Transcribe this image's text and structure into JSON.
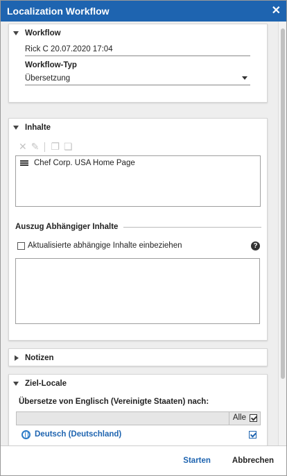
{
  "dialog": {
    "title": "Localization Workflow"
  },
  "workflow_panel": {
    "header": "Workflow",
    "name_value": "Rick C 20.07.2020 17:04",
    "type_label": "Workflow-Typ",
    "type_value": "Übersetzung"
  },
  "contents_panel": {
    "header": "Inhalte",
    "items": [
      "Chef Corp. USA Home Page"
    ],
    "dependent_section_title": "Auszug Abhängiger Inhalte",
    "include_dependent_label": "Aktualisierte abhängige Inhalte einbeziehen",
    "help_glyph": "?"
  },
  "notes_panel": {
    "header": "Notizen"
  },
  "target_locales_panel": {
    "header": "Ziel-Locale",
    "translate_from_label": "Übersetze von Englisch (Vereinigte Staaten) nach:",
    "all_label": "Alle",
    "locales": [
      {
        "label": "Deutsch (Deutschland)",
        "checked": true
      }
    ]
  },
  "footer": {
    "start_label": "Starten",
    "cancel_label": "Abbrechen"
  },
  "colors": {
    "title_bar": "#1e64b0",
    "link": "#1e64b0"
  },
  "icons": {
    "close": "close-icon",
    "remove": "remove-icon",
    "edit": "edit-icon",
    "copy": "copy-icon",
    "paste": "paste-icon",
    "list": "list-icon",
    "help": "help-icon",
    "globe": "globe-icon"
  }
}
